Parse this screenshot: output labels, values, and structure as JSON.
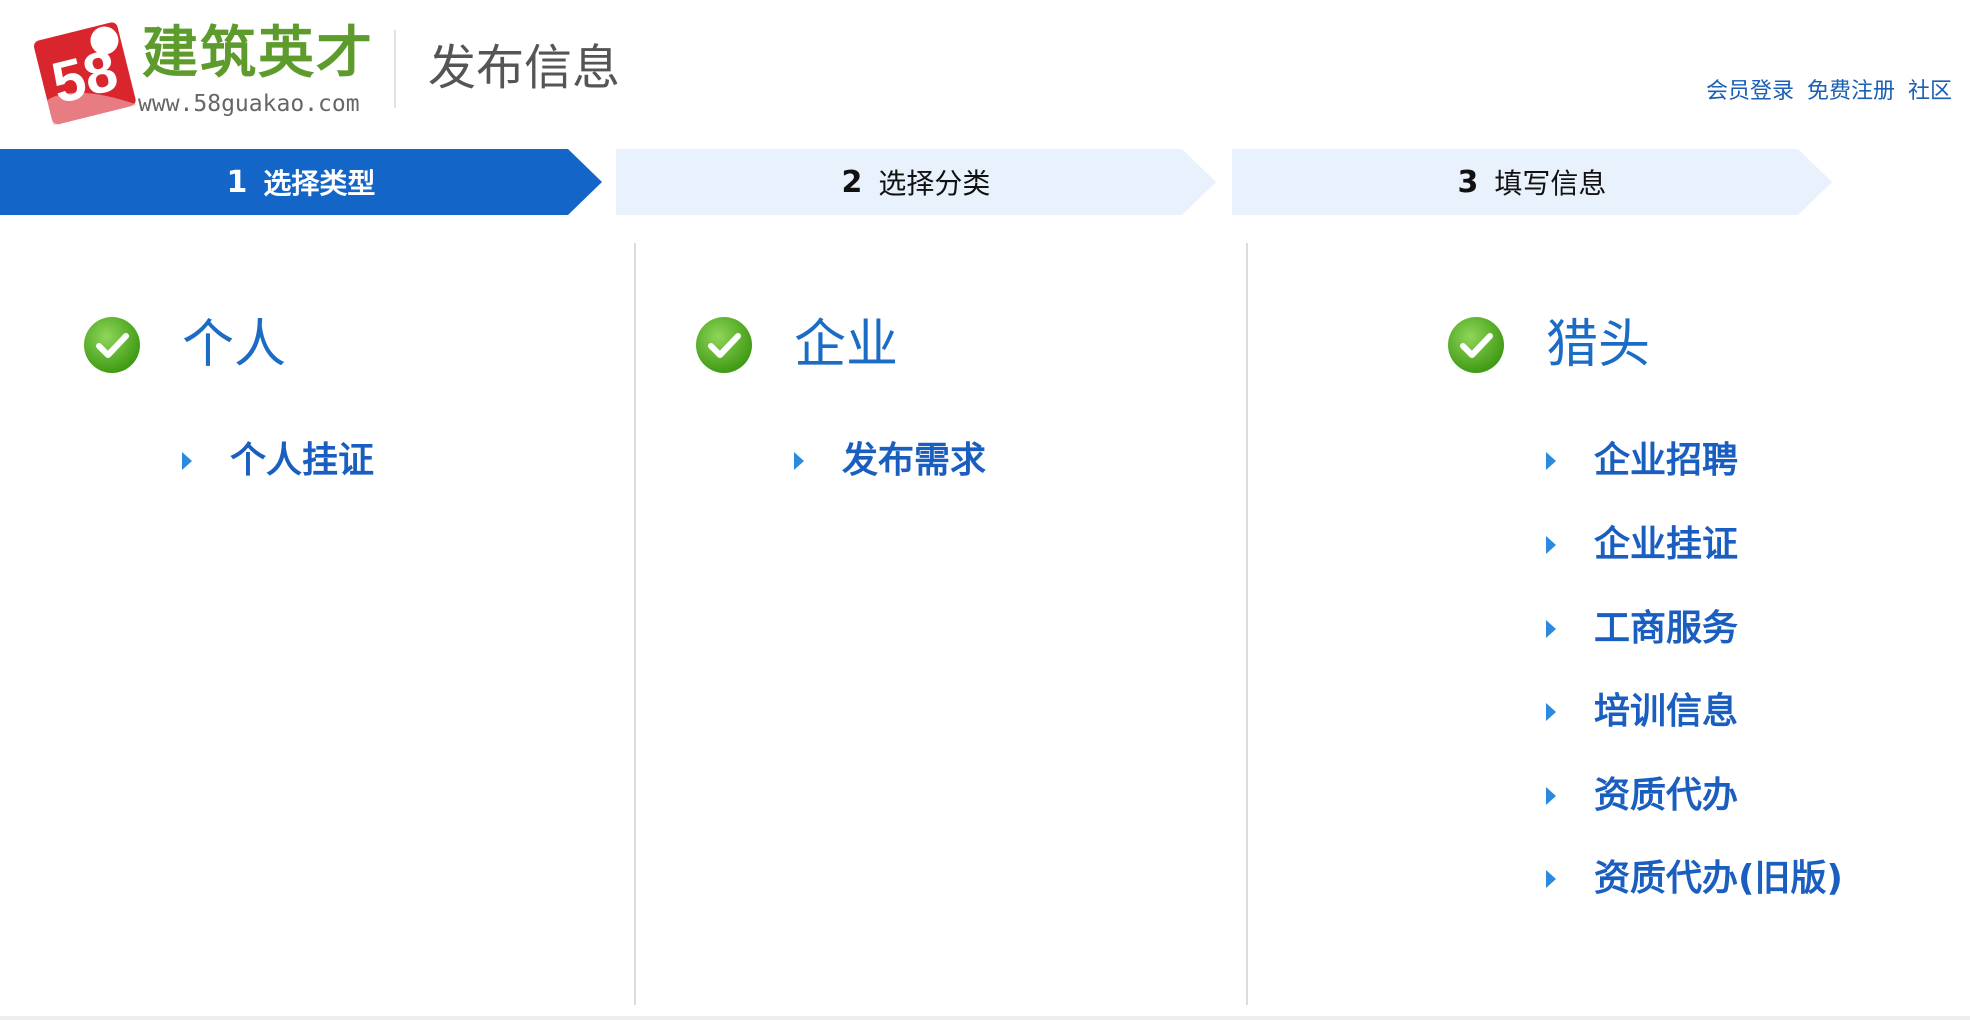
{
  "header": {
    "logo_number": "58",
    "logo_title": "建筑英才",
    "logo_url": "www.58guakao.com",
    "page_title": "发布信息",
    "links": [
      "会员登录",
      "免费注册",
      "社区"
    ]
  },
  "steps": [
    {
      "num": "1",
      "label": "选择类型",
      "active": true
    },
    {
      "num": "2",
      "label": "选择分类",
      "active": false
    },
    {
      "num": "3",
      "label": "填写信息",
      "active": false
    }
  ],
  "columns": [
    {
      "title": "个人",
      "icon": "check-circle-icon",
      "items": [
        "个人挂证"
      ]
    },
    {
      "title": "企业",
      "icon": "check-circle-icon",
      "items": [
        "发布需求"
      ]
    },
    {
      "title": "猎头",
      "icon": "check-circle-icon",
      "items": [
        "企业招聘",
        "企业挂证",
        "工商服务",
        "培训信息",
        "资质代办",
        "资质代办(旧版)"
      ]
    }
  ],
  "colors": {
    "brand_blue": "#1366c8",
    "step_inactive_bg": "#e8f1fc",
    "link_blue": "#1a5fb4",
    "logo_green": "#5d9b2c",
    "logo_red": "#d9252e",
    "check_green": "#4aa81e"
  }
}
